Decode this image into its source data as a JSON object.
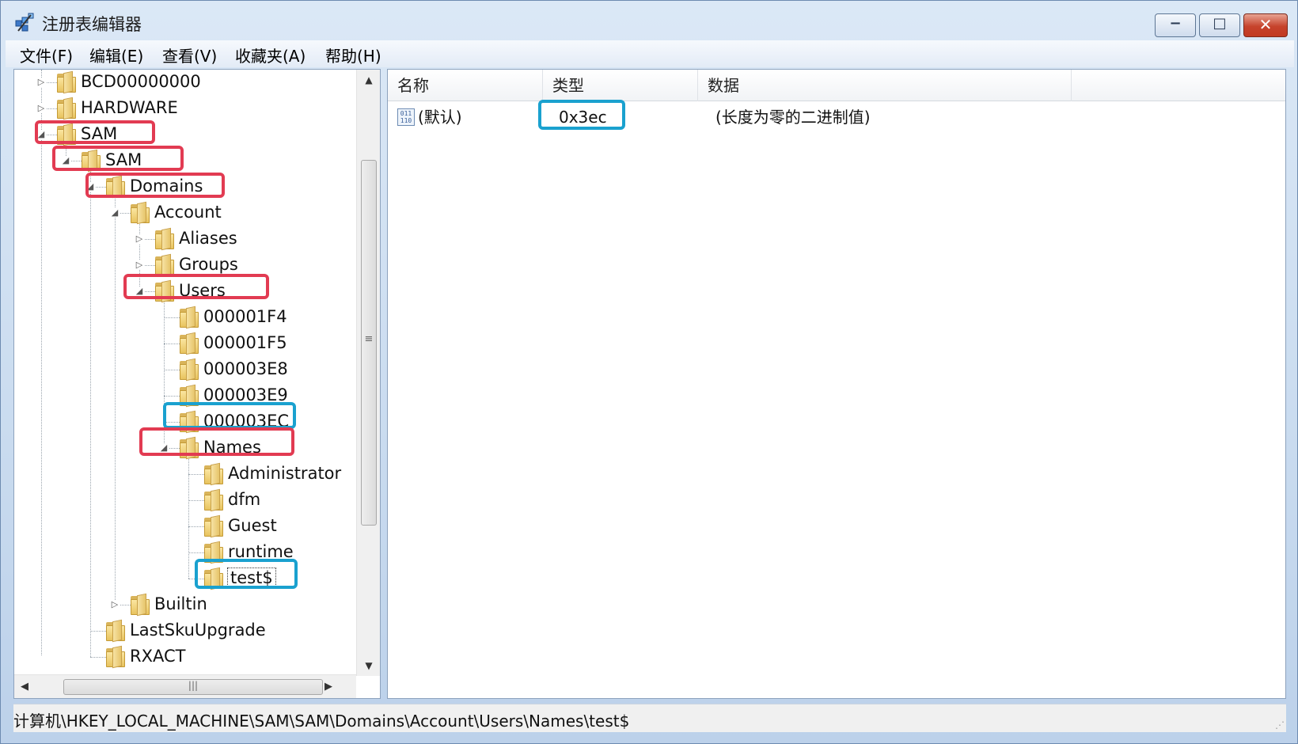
{
  "window": {
    "title": "注册表编辑器"
  },
  "menu": [
    "文件(F)",
    "编辑(E)",
    "查看(V)",
    "收藏夹(A)",
    "帮助(H)"
  ],
  "tree": [
    {
      "label": "BCD00000000",
      "level": 0,
      "expander": "collapsed"
    },
    {
      "label": "HARDWARE",
      "level": 0,
      "expander": "collapsed"
    },
    {
      "label": "SAM",
      "level": 0,
      "expander": "expanded"
    },
    {
      "label": "SAM",
      "level": 1,
      "expander": "expanded"
    },
    {
      "label": "Domains",
      "level": 2,
      "expander": "expanded"
    },
    {
      "label": "Account",
      "level": 3,
      "expander": "expanded"
    },
    {
      "label": "Aliases",
      "level": 4,
      "expander": "collapsed"
    },
    {
      "label": "Groups",
      "level": 4,
      "expander": "collapsed"
    },
    {
      "label": "Users",
      "level": 4,
      "expander": "expanded"
    },
    {
      "label": "000001F4",
      "level": 5,
      "expander": "none"
    },
    {
      "label": "000001F5",
      "level": 5,
      "expander": "none"
    },
    {
      "label": "000003E8",
      "level": 5,
      "expander": "none"
    },
    {
      "label": "000003E9",
      "level": 5,
      "expander": "none"
    },
    {
      "label": "000003EC",
      "level": 5,
      "expander": "none"
    },
    {
      "label": "Names",
      "level": 5,
      "expander": "expanded"
    },
    {
      "label": "Administrator",
      "level": 6,
      "expander": "none"
    },
    {
      "label": "dfm",
      "level": 6,
      "expander": "none"
    },
    {
      "label": "Guest",
      "level": 6,
      "expander": "none"
    },
    {
      "label": "runtime",
      "level": 6,
      "expander": "none"
    },
    {
      "label": "test$",
      "level": 6,
      "expander": "none",
      "selected": true
    },
    {
      "label": "Builtin",
      "level": 3,
      "expander": "collapsed"
    },
    {
      "label": "LastSkuUpgrade",
      "level": 2,
      "expander": "none"
    },
    {
      "label": "RXACT",
      "level": 2,
      "expander": "none"
    }
  ],
  "list": {
    "columns": [
      "名称",
      "类型",
      "数据"
    ],
    "rows": [
      {
        "name": "(默认)",
        "type": "0x3ec",
        "data": "(长度为零的二进制值)",
        "icon": "binary-value-icon"
      }
    ]
  },
  "status": {
    "path": "计算机\\HKEY_LOCAL_MACHINE\\SAM\\SAM\\Domains\\Account\\Users\\Names\\test$"
  },
  "colors": {
    "highlight_red": "#e23b52",
    "highlight_blue": "#1aa1cf"
  },
  "annotations": {
    "red": [
      "SAM",
      "SAM",
      "Domains",
      "Users",
      "Names"
    ],
    "blue": [
      "000003EC",
      "test$",
      "0x3ec"
    ]
  }
}
